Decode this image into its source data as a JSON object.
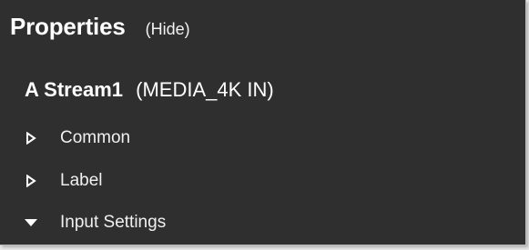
{
  "panel": {
    "title": "Properties",
    "hide_label": "(Hide)",
    "background": "#2f2f2f"
  },
  "object": {
    "name": "A Stream1",
    "type": "(MEDIA_4K IN)"
  },
  "sections": [
    {
      "label": "Common",
      "expanded": false,
      "icon": "triangle-right-icon"
    },
    {
      "label": "Label",
      "expanded": false,
      "icon": "triangle-right-icon"
    },
    {
      "label": "Input Settings",
      "expanded": true,
      "icon": "triangle-down-icon"
    }
  ]
}
